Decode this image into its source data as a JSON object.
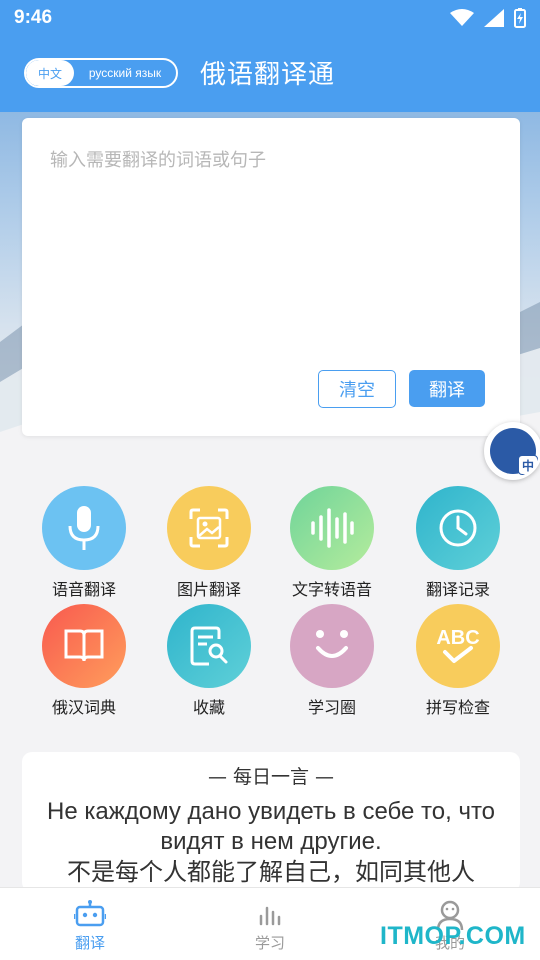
{
  "status_bar": {
    "time": "9:46"
  },
  "header": {
    "lang_zh": "中文",
    "lang_ru": "русский язык",
    "title": "俄语翻译通"
  },
  "input": {
    "placeholder": "输入需要翻译的词语或句子",
    "clear_label": "清空",
    "translate_label": "翻译"
  },
  "float_badge": {
    "label": "中"
  },
  "features": [
    {
      "label": "语音翻译",
      "icon": "microphone-icon",
      "color": "#6cc2f2"
    },
    {
      "label": "图片翻译",
      "icon": "image-scan-icon",
      "color": "#f8cc5c"
    },
    {
      "label": "文字转语音",
      "icon": "sound-wave-icon",
      "color": "#8edc8e"
    },
    {
      "label": "翻译记录",
      "icon": "clock-icon",
      "color": "#3dbfd0"
    },
    {
      "label": "俄汉词典",
      "icon": "book-icon",
      "color": "#f66a5e"
    },
    {
      "label": "收藏",
      "icon": "document-search-icon",
      "color": "#3dbfd0"
    },
    {
      "label": "学习圈",
      "icon": "smile-icon",
      "color": "#d7a6c4"
    },
    {
      "label": "拼写检查",
      "icon": "abc-check-icon",
      "color": "#f8cc5c"
    }
  ],
  "quote": {
    "title": "— 每日一言 —",
    "ru": "Не каждому дано увидеть в себе то, что видят в нем другие.",
    "zh": "不是每个人都能了解自己，如同其他人"
  },
  "nav": {
    "items": [
      {
        "label": "翻译",
        "icon": "robot-icon",
        "active": true
      },
      {
        "label": "学习",
        "icon": "bar-chart-icon",
        "active": false
      },
      {
        "label": "我的",
        "icon": "person-icon",
        "active": false
      }
    ]
  },
  "watermark": "ITMOP.COM",
  "colors": {
    "accent": "#4a9ef0"
  }
}
